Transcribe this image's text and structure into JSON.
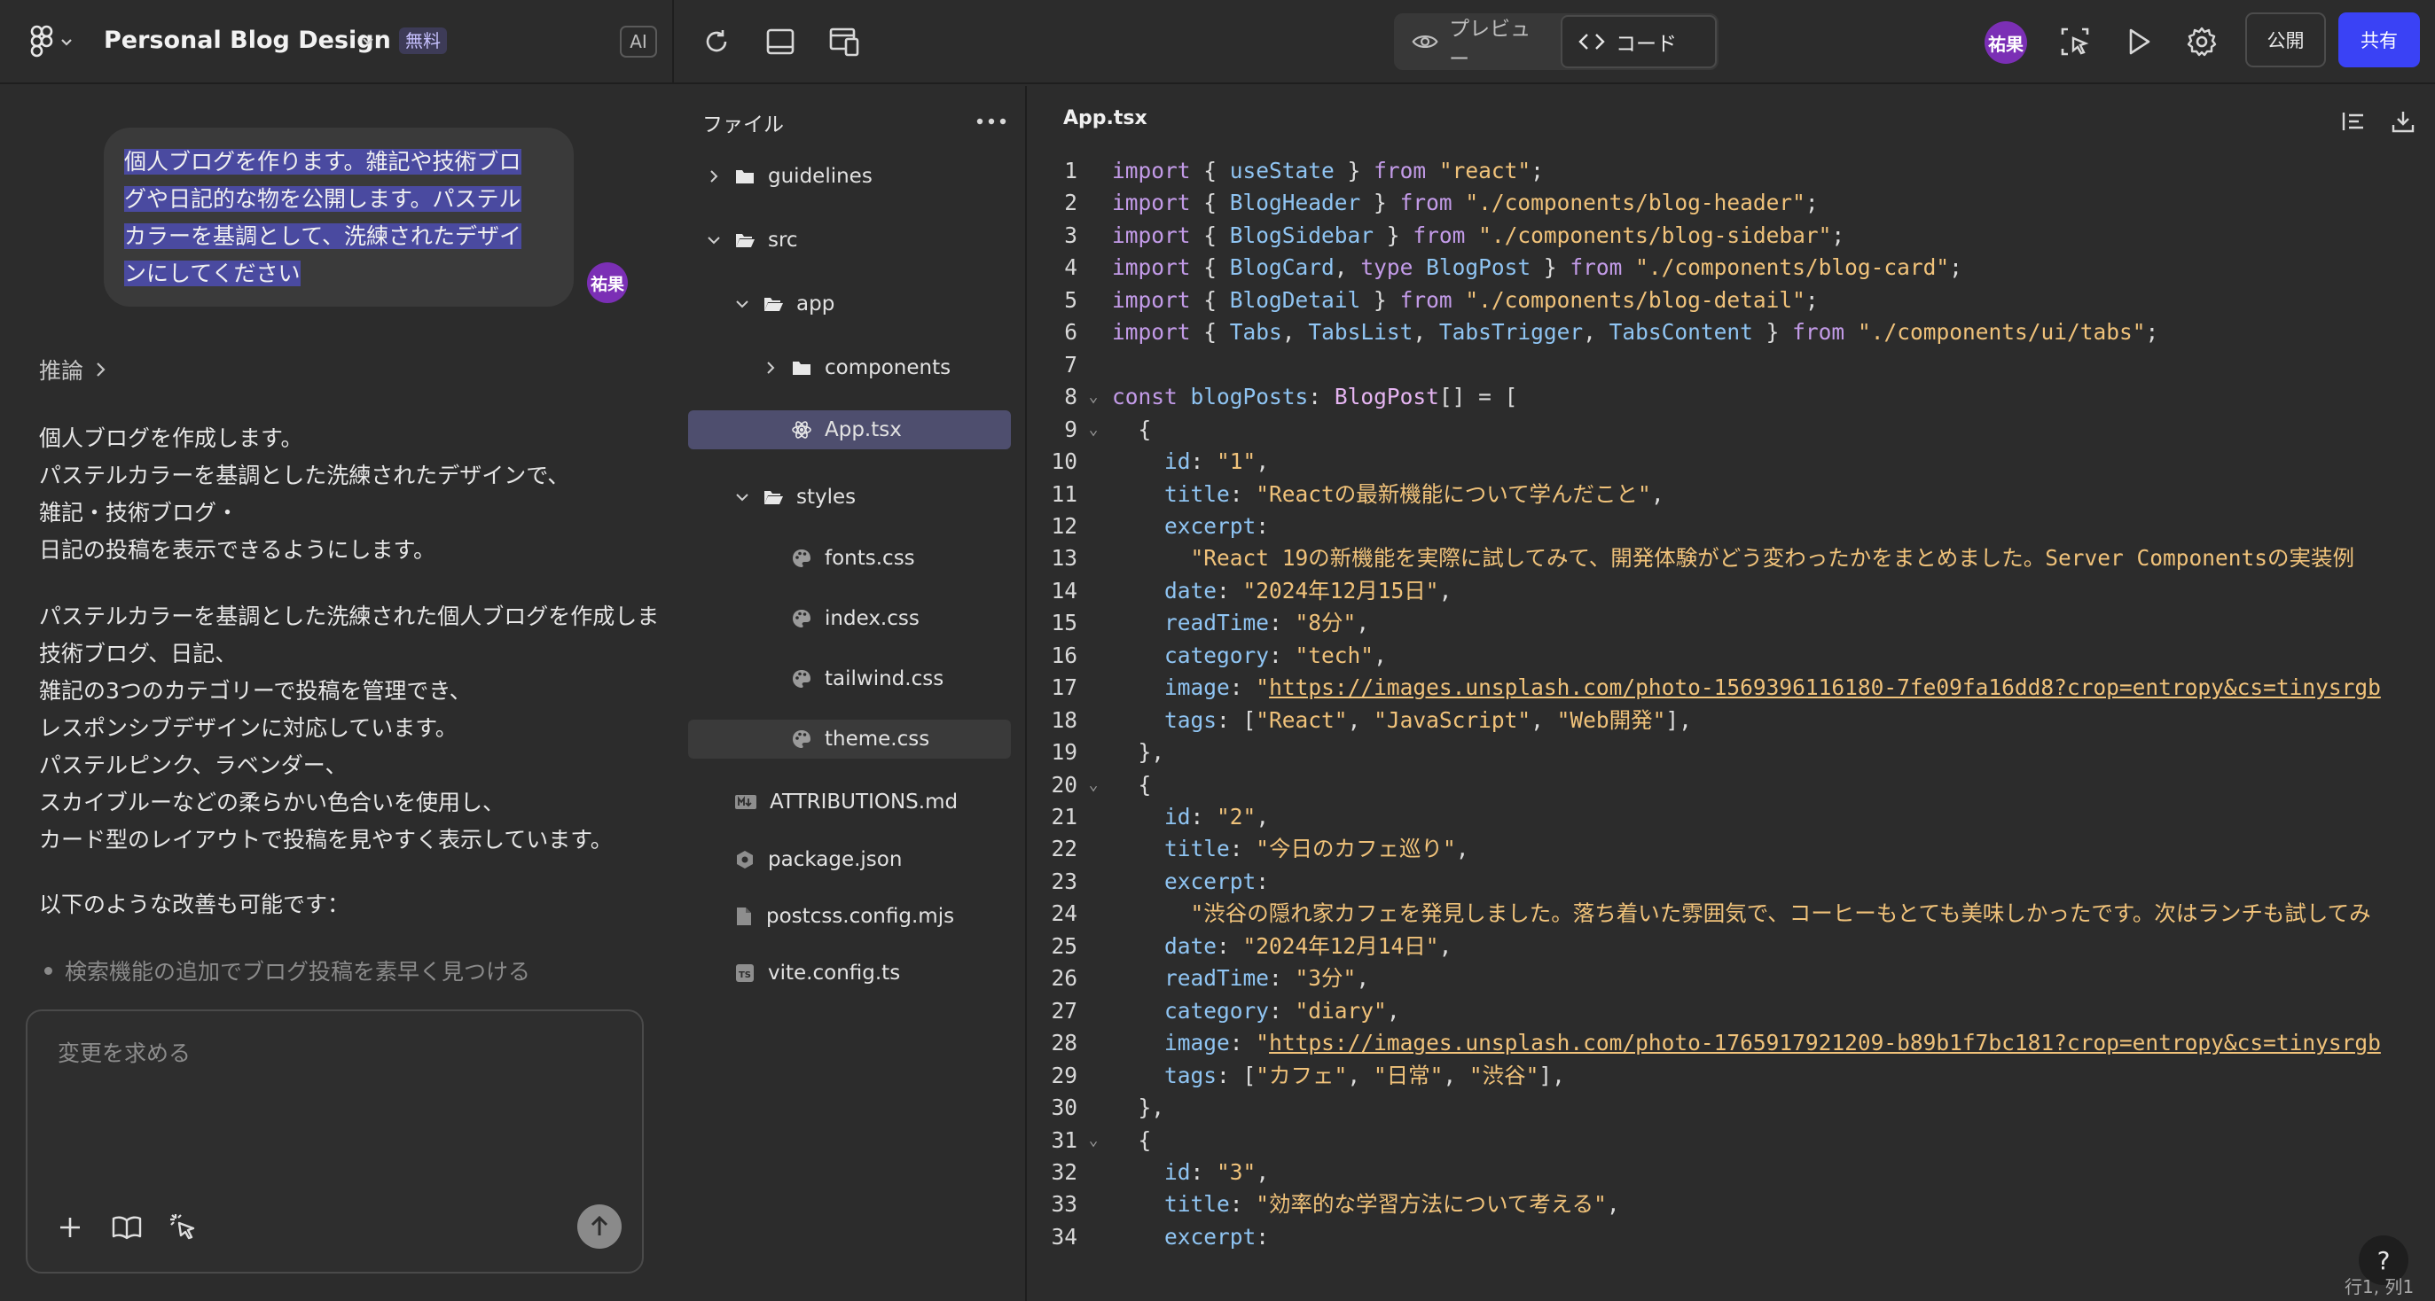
{
  "header": {
    "project_title": "Personal Blog Design",
    "plan_badge": "無料",
    "ai_label": "AI",
    "preview_label": "プレビュー",
    "code_label": "コード",
    "avatar_initials": "祐果",
    "publish_label": "公開",
    "share_label": "共有"
  },
  "chat": {
    "user_message_lines": [
      "個人ブログを作ります。雑記や技術ブロ",
      "グや日記的な物を公開します。パステル",
      "カラーを基調として、洗練されたデザイ",
      "ンにしてください"
    ],
    "user_avatar": "祐果",
    "reasoning_label": "推論",
    "reply_paragraphs": [
      [
        "個人ブログを作成します。",
        "パステルカラーを基調とした洗練されたデザインで、",
        "雑記・技術ブログ・",
        "日記の投稿を表示できるようにします。"
      ],
      [
        "パステルカラーを基調とした洗練された個人ブログを作成しま",
        "技術ブログ、日記、",
        "雑記の3つのカテゴリーで投稿を管理でき、",
        "レスポンシブデザインに対応しています。",
        "パステルピンク、ラベンダー、",
        "スカイブルーなどの柔らかい色合いを使用し、",
        "カード型のレイアウトで投稿を見やすく表示しています。"
      ],
      [
        "以下のような改善も可能です："
      ]
    ],
    "bullet": "検索機能の追加でブログ投稿を素早く見つける",
    "input_placeholder": "変更を求める"
  },
  "files": {
    "title": "ファイル",
    "items": [
      {
        "label": "guidelines",
        "kind": "folder",
        "chevron": "right",
        "depth": 0
      },
      {
        "label": "src",
        "kind": "folder-open",
        "chevron": "down",
        "depth": 0
      },
      {
        "label": "app",
        "kind": "folder-open",
        "chevron": "down",
        "depth": 1
      },
      {
        "label": "components",
        "kind": "folder",
        "chevron": "right",
        "depth": 2
      },
      {
        "label": "App.tsx",
        "kind": "react",
        "chevron": "",
        "depth": 2,
        "state": "active"
      },
      {
        "label": "styles",
        "kind": "folder-open",
        "chevron": "down",
        "depth": 1
      },
      {
        "label": "fonts.css",
        "kind": "palette",
        "chevron": "",
        "depth": 2
      },
      {
        "label": "index.css",
        "kind": "palette",
        "chevron": "",
        "depth": 2
      },
      {
        "label": "tailwind.css",
        "kind": "palette",
        "chevron": "",
        "depth": 2
      },
      {
        "label": "theme.css",
        "kind": "palette",
        "chevron": "",
        "depth": 2,
        "state": "soft"
      },
      {
        "label": "ATTRIBUTIONS.md",
        "kind": "md",
        "chevron": "",
        "depth": 0
      },
      {
        "label": "package.json",
        "kind": "hex",
        "chevron": "",
        "depth": 0
      },
      {
        "label": "postcss.config.mjs",
        "kind": "file",
        "chevron": "",
        "depth": 0
      },
      {
        "label": "vite.config.ts",
        "kind": "ts",
        "chevron": "",
        "depth": 0
      }
    ]
  },
  "editor": {
    "tab_label": "App.tsx",
    "status_text": "行1, 列1",
    "lines": [
      {
        "n": "1",
        "fold": "",
        "toks": [
          [
            "k",
            "import"
          ],
          [
            "p",
            " { "
          ],
          [
            "v",
            "useState"
          ],
          [
            "p",
            " } "
          ],
          [
            "k",
            "from"
          ],
          [
            "p",
            " "
          ],
          [
            "s",
            "\"react\""
          ],
          [
            "p",
            ";"
          ]
        ]
      },
      {
        "n": "2",
        "fold": "",
        "toks": [
          [
            "k",
            "import"
          ],
          [
            "p",
            " { "
          ],
          [
            "v",
            "BlogHeader"
          ],
          [
            "p",
            " } "
          ],
          [
            "k",
            "from"
          ],
          [
            "p",
            " "
          ],
          [
            "s",
            "\"./components/blog-header\""
          ],
          [
            "p",
            ";"
          ]
        ]
      },
      {
        "n": "3",
        "fold": "",
        "toks": [
          [
            "k",
            "import"
          ],
          [
            "p",
            " { "
          ],
          [
            "v",
            "BlogSidebar"
          ],
          [
            "p",
            " } "
          ],
          [
            "k",
            "from"
          ],
          [
            "p",
            " "
          ],
          [
            "s",
            "\"./components/blog-sidebar\""
          ],
          [
            "p",
            ";"
          ]
        ]
      },
      {
        "n": "4",
        "fold": "",
        "toks": [
          [
            "k",
            "import"
          ],
          [
            "p",
            " { "
          ],
          [
            "v",
            "BlogCard"
          ],
          [
            "p",
            ", "
          ],
          [
            "k",
            "type"
          ],
          [
            "p",
            " "
          ],
          [
            "v",
            "BlogPost"
          ],
          [
            "p",
            " } "
          ],
          [
            "k",
            "from"
          ],
          [
            "p",
            " "
          ],
          [
            "s",
            "\"./components/blog-card\""
          ],
          [
            "p",
            ";"
          ]
        ]
      },
      {
        "n": "5",
        "fold": "",
        "toks": [
          [
            "k",
            "import"
          ],
          [
            "p",
            " { "
          ],
          [
            "v",
            "BlogDetail"
          ],
          [
            "p",
            " } "
          ],
          [
            "k",
            "from"
          ],
          [
            "p",
            " "
          ],
          [
            "s",
            "\"./components/blog-detail\""
          ],
          [
            "p",
            ";"
          ]
        ]
      },
      {
        "n": "6",
        "fold": "",
        "toks": [
          [
            "k",
            "import"
          ],
          [
            "p",
            " { "
          ],
          [
            "v",
            "Tabs"
          ],
          [
            "p",
            ", "
          ],
          [
            "v",
            "TabsList"
          ],
          [
            "p",
            ", "
          ],
          [
            "v",
            "TabsTrigger"
          ],
          [
            "p",
            ", "
          ],
          [
            "v",
            "TabsContent"
          ],
          [
            "p",
            " } "
          ],
          [
            "k",
            "from"
          ],
          [
            "p",
            " "
          ],
          [
            "s",
            "\"./components/ui/tabs\""
          ],
          [
            "p",
            ";"
          ]
        ]
      },
      {
        "n": "7",
        "fold": "",
        "toks": []
      },
      {
        "n": "8",
        "fold": "v",
        "toks": [
          [
            "k",
            "const"
          ],
          [
            "p",
            " "
          ],
          [
            "v",
            "blogPosts"
          ],
          [
            "p",
            ": "
          ],
          [
            "t",
            "BlogPost"
          ],
          [
            "p",
            "[] = ["
          ]
        ]
      },
      {
        "n": "9",
        "fold": "v",
        "toks": [
          [
            "p",
            "  {"
          ]
        ]
      },
      {
        "n": "10",
        "fold": "",
        "toks": [
          [
            "p",
            "    "
          ],
          [
            "v",
            "id"
          ],
          [
            "p",
            ": "
          ],
          [
            "s",
            "\"1\""
          ],
          [
            "p",
            ","
          ]
        ]
      },
      {
        "n": "11",
        "fold": "",
        "toks": [
          [
            "p",
            "    "
          ],
          [
            "v",
            "title"
          ],
          [
            "p",
            ": "
          ],
          [
            "s",
            "\"Reactの最新機能について学んだこと\""
          ],
          [
            "p",
            ","
          ]
        ]
      },
      {
        "n": "12",
        "fold": "",
        "toks": [
          [
            "p",
            "    "
          ],
          [
            "v",
            "excerpt"
          ],
          [
            "p",
            ":"
          ]
        ]
      },
      {
        "n": "13",
        "fold": "",
        "toks": [
          [
            "p",
            "      "
          ],
          [
            "s",
            "\"React 19の新機能を実際に試してみて、開発体験がどう変わったかをまとめました。Server Componentsの実装例"
          ]
        ]
      },
      {
        "n": "14",
        "fold": "",
        "toks": [
          [
            "p",
            "    "
          ],
          [
            "v",
            "date"
          ],
          [
            "p",
            ": "
          ],
          [
            "s",
            "\"2024年12月15日\""
          ],
          [
            "p",
            ","
          ]
        ]
      },
      {
        "n": "15",
        "fold": "",
        "toks": [
          [
            "p",
            "    "
          ],
          [
            "v",
            "readTime"
          ],
          [
            "p",
            ": "
          ],
          [
            "s",
            "\"8分\""
          ],
          [
            "p",
            ","
          ]
        ]
      },
      {
        "n": "16",
        "fold": "",
        "toks": [
          [
            "p",
            "    "
          ],
          [
            "v",
            "category"
          ],
          [
            "p",
            ": "
          ],
          [
            "s",
            "\"tech\""
          ],
          [
            "p",
            ","
          ]
        ]
      },
      {
        "n": "17",
        "fold": "",
        "toks": [
          [
            "p",
            "    "
          ],
          [
            "v",
            "image"
          ],
          [
            "p",
            ": "
          ],
          [
            "s",
            "\""
          ],
          [
            "u",
            "https://images.unsplash.com/photo-1569396116180-7fe09fa16dd8?crop=entropy&cs=tinysrgb"
          ]
        ]
      },
      {
        "n": "18",
        "fold": "",
        "toks": [
          [
            "p",
            "    "
          ],
          [
            "v",
            "tags"
          ],
          [
            "p",
            ": ["
          ],
          [
            "s",
            "\"React\""
          ],
          [
            "p",
            ", "
          ],
          [
            "s",
            "\"JavaScript\""
          ],
          [
            "p",
            ", "
          ],
          [
            "s",
            "\"Web開発\""
          ],
          [
            "p",
            "],"
          ]
        ]
      },
      {
        "n": "19",
        "fold": "",
        "toks": [
          [
            "p",
            "  },"
          ]
        ]
      },
      {
        "n": "20",
        "fold": "v",
        "toks": [
          [
            "p",
            "  {"
          ]
        ]
      },
      {
        "n": "21",
        "fold": "",
        "toks": [
          [
            "p",
            "    "
          ],
          [
            "v",
            "id"
          ],
          [
            "p",
            ": "
          ],
          [
            "s",
            "\"2\""
          ],
          [
            "p",
            ","
          ]
        ]
      },
      {
        "n": "22",
        "fold": "",
        "toks": [
          [
            "p",
            "    "
          ],
          [
            "v",
            "title"
          ],
          [
            "p",
            ": "
          ],
          [
            "s",
            "\"今日のカフェ巡り\""
          ],
          [
            "p",
            ","
          ]
        ]
      },
      {
        "n": "23",
        "fold": "",
        "toks": [
          [
            "p",
            "    "
          ],
          [
            "v",
            "excerpt"
          ],
          [
            "p",
            ":"
          ]
        ]
      },
      {
        "n": "24",
        "fold": "",
        "toks": [
          [
            "p",
            "      "
          ],
          [
            "s",
            "\"渋谷の隠れ家カフェを発見しました。落ち着いた雰囲気で、コーヒーもとても美味しかったです。次はランチも試してみ"
          ]
        ]
      },
      {
        "n": "25",
        "fold": "",
        "toks": [
          [
            "p",
            "    "
          ],
          [
            "v",
            "date"
          ],
          [
            "p",
            ": "
          ],
          [
            "s",
            "\"2024年12月14日\""
          ],
          [
            "p",
            ","
          ]
        ]
      },
      {
        "n": "26",
        "fold": "",
        "toks": [
          [
            "p",
            "    "
          ],
          [
            "v",
            "readTime"
          ],
          [
            "p",
            ": "
          ],
          [
            "s",
            "\"3分\""
          ],
          [
            "p",
            ","
          ]
        ]
      },
      {
        "n": "27",
        "fold": "",
        "toks": [
          [
            "p",
            "    "
          ],
          [
            "v",
            "category"
          ],
          [
            "p",
            ": "
          ],
          [
            "s",
            "\"diary\""
          ],
          [
            "p",
            ","
          ]
        ]
      },
      {
        "n": "28",
        "fold": "",
        "toks": [
          [
            "p",
            "    "
          ],
          [
            "v",
            "image"
          ],
          [
            "p",
            ": "
          ],
          [
            "s",
            "\""
          ],
          [
            "u",
            "https://images.unsplash.com/photo-1765917921209-b89b1f7bc181?crop=entropy&cs=tinysrgb"
          ]
        ]
      },
      {
        "n": "29",
        "fold": "",
        "toks": [
          [
            "p",
            "    "
          ],
          [
            "v",
            "tags"
          ],
          [
            "p",
            ": ["
          ],
          [
            "s",
            "\"カフェ\""
          ],
          [
            "p",
            ", "
          ],
          [
            "s",
            "\"日常\""
          ],
          [
            "p",
            ", "
          ],
          [
            "s",
            "\"渋谷\""
          ],
          [
            "p",
            "],"
          ]
        ]
      },
      {
        "n": "30",
        "fold": "",
        "toks": [
          [
            "p",
            "  },"
          ]
        ]
      },
      {
        "n": "31",
        "fold": "v",
        "toks": [
          [
            "p",
            "  {"
          ]
        ]
      },
      {
        "n": "32",
        "fold": "",
        "toks": [
          [
            "p",
            "    "
          ],
          [
            "v",
            "id"
          ],
          [
            "p",
            ": "
          ],
          [
            "s",
            "\"3\""
          ],
          [
            "p",
            ","
          ]
        ]
      },
      {
        "n": "33",
        "fold": "",
        "toks": [
          [
            "p",
            "    "
          ],
          [
            "v",
            "title"
          ],
          [
            "p",
            ": "
          ],
          [
            "s",
            "\"効率的な学習方法について考える\""
          ],
          [
            "p",
            ","
          ]
        ]
      },
      {
        "n": "34",
        "fold": "",
        "toks": [
          [
            "p",
            "    "
          ],
          [
            "v",
            "excerpt"
          ],
          [
            "p",
            ":"
          ]
        ]
      }
    ]
  }
}
